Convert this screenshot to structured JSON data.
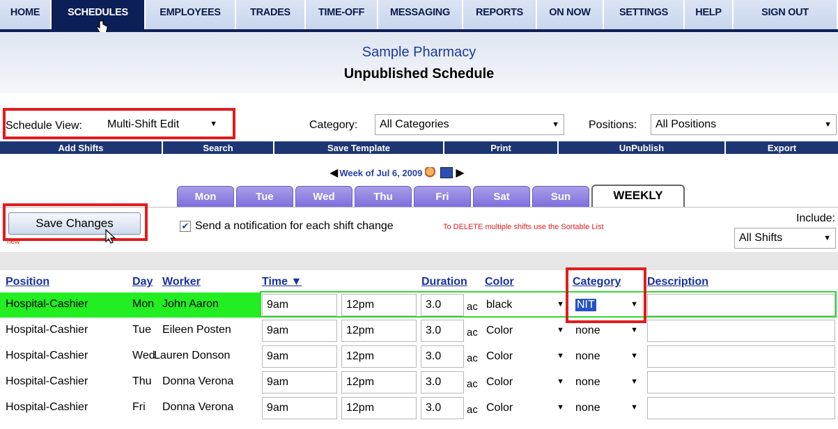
{
  "nav": {
    "items": [
      {
        "label": "HOME",
        "w": 74
      },
      {
        "label": "SCHEDULES",
        "w": 135
      },
      {
        "label": "EMPLOYEES",
        "w": 130
      },
      {
        "label": "TRADES",
        "w": 100
      },
      {
        "label": "TIME-OFF",
        "w": 104
      },
      {
        "label": "MESSAGING",
        "w": 122
      },
      {
        "label": "REPORTS",
        "w": 106
      },
      {
        "label": "ON NOW",
        "w": 96
      },
      {
        "label": "SETTINGS",
        "w": 116
      },
      {
        "label": "HELP",
        "w": 70
      },
      {
        "label": "SIGN OUT",
        "w": 150
      }
    ],
    "active": "SCHEDULES"
  },
  "header": {
    "org": "Sample Pharmacy",
    "title": "Unpublished Schedule"
  },
  "filters": {
    "view_label": "Schedule View:",
    "view_value": "Multi-Shift Edit",
    "category_label": "Category:",
    "category_value": "All Categories",
    "positions_label": "Positions:",
    "positions_value": "All Positions"
  },
  "actions": [
    "Add Shifts",
    "Search",
    "Save Template",
    "Print",
    "UnPublish",
    "Export"
  ],
  "week": {
    "label": "Week of Jul 6, 2009"
  },
  "tabs": [
    "Mon",
    "Tue",
    "Wed",
    "Thu",
    "Fri",
    "Sat",
    "Sun"
  ],
  "tab_weekly": "WEEKLY",
  "save_button": "Save Changes",
  "new_tag": "new",
  "notify_text": "Send a notification for each shift change",
  "delete_note": "To DELETE multiple shifts use the Sortable List",
  "include": {
    "label": "Include:",
    "value": "All Shifts"
  },
  "table": {
    "headers": {
      "position": "Position",
      "day": "Day",
      "worker": "Worker",
      "time": "Time ▼",
      "duration": "Duration",
      "color": "Color",
      "category": "Category",
      "description": "Description"
    },
    "ac_label": "ac",
    "rows": [
      {
        "position": "Hospital-Cashier",
        "day": "Mon",
        "worker": "John Aaron",
        "start": "9am",
        "end": "12pm",
        "duration": "3.0",
        "color": "black",
        "category": "NIT",
        "highlight": true
      },
      {
        "position": "Hospital-Cashier",
        "day": "Tue",
        "worker": "Eileen Posten",
        "start": "9am",
        "end": "12pm",
        "duration": "3.0",
        "color": "Color",
        "category": "none",
        "highlight": false
      },
      {
        "position": "Hospital-Cashier",
        "day": "Wed",
        "worker": "Lauren Donson",
        "start": "9am",
        "end": "12pm",
        "duration": "3.0",
        "color": "Color",
        "category": "none",
        "highlight": false
      },
      {
        "position": "Hospital-Cashier",
        "day": "Thu",
        "worker": "Donna Verona",
        "start": "9am",
        "end": "12pm",
        "duration": "3.0",
        "color": "Color",
        "category": "none",
        "highlight": false
      },
      {
        "position": "Hospital-Cashier",
        "day": "Fri",
        "worker": "Donna Verona",
        "start": "9am",
        "end": "12pm",
        "duration": "3.0",
        "color": "Color",
        "category": "none",
        "highlight": false
      }
    ]
  }
}
